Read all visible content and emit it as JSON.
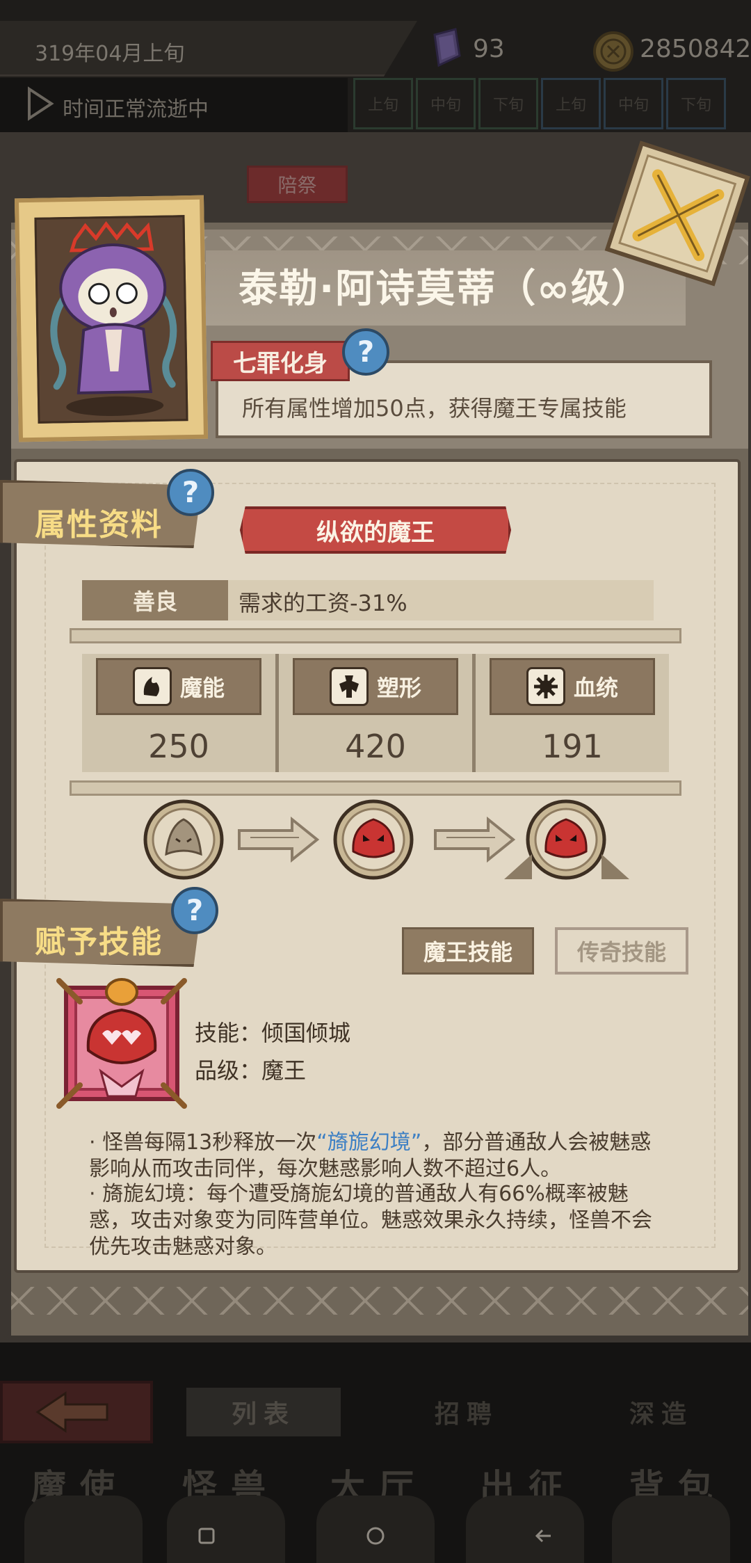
{
  "topbar": {
    "date": "319年04月上旬",
    "gems": "93",
    "coins": "2850842",
    "time_status": "时间正常流逝中",
    "timeline_cells": [
      "上旬",
      "中旬",
      "下旬",
      "上旬",
      "中旬",
      "下旬"
    ]
  },
  "background": {
    "tab_label": "陪祭"
  },
  "character": {
    "name": "泰勒·阿诗莫蒂（∞级）",
    "trait_name": "七罪化身",
    "trait_desc": "所有属性增加50点，获得魔王专属技能"
  },
  "attributes": {
    "section_title": "属性资料",
    "class_title": "纵欲的魔王",
    "alignment": "善良",
    "alignment_effect": "需求的工资-31%",
    "stats": [
      {
        "name": "魔能",
        "value": "250",
        "icon": "magic-power-icon"
      },
      {
        "name": "塑形",
        "value": "420",
        "icon": "body-shape-icon"
      },
      {
        "name": "血统",
        "value": "191",
        "icon": "bloodline-icon"
      }
    ]
  },
  "skills": {
    "section_title": "赋予技能",
    "tab_demon": "魔王技能",
    "tab_legend": "传奇技能",
    "skill_label": "技能：",
    "skill_name": "倾国倾城",
    "grade_label": "品级：",
    "grade_value": "魔王",
    "desc1_a": "·   怪兽每隔13秒释放一次",
    "desc1_hl": "“旖旎幻境”",
    "desc1_b": "，部分普通敌人会被魅惑影响从而攻击同伴，每次魅惑影响人数不超过6人。",
    "desc2": "·   旖旎幻境：每个遭受旖旎幻境的普通敌人有66%概率被魅惑，攻击对象变为同阵营单位。魅惑效果永久持续，怪兽不会优先攻击魅惑对象。"
  },
  "bottom": {
    "tabs": [
      "列表",
      "招聘",
      "深造"
    ],
    "nav": [
      "魔使",
      "怪兽",
      "大厅",
      "出征",
      "背包"
    ]
  },
  "colors": {
    "accent_red": "#c44a44",
    "gold_title": "#f7dc86",
    "highlight_blue": "#3c7fc4",
    "parchment": "#e2d8c5"
  }
}
